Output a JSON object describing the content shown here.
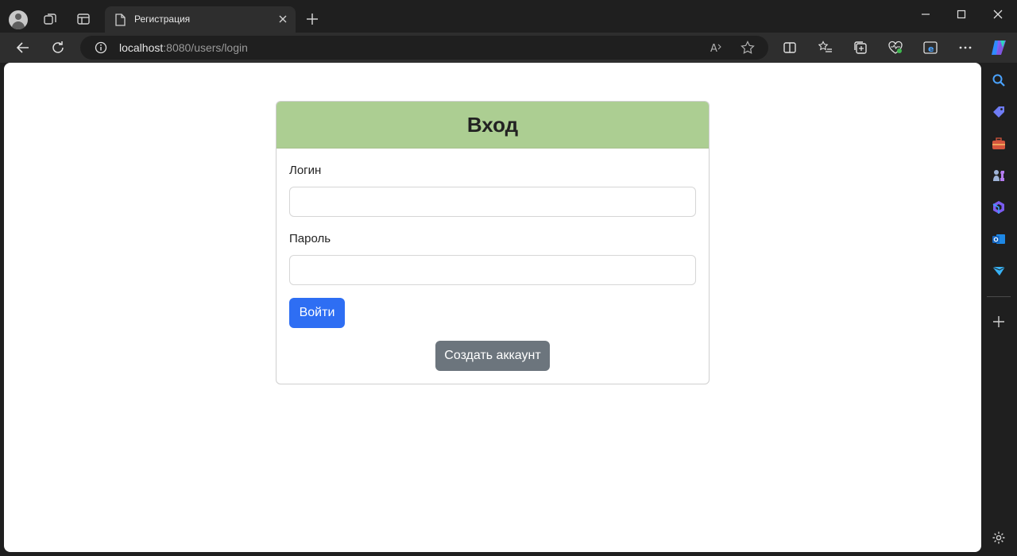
{
  "browser": {
    "tab_title": "Регистрация",
    "url_host": "localhost",
    "url_rest": ":8080/users/login",
    "read_aloud_label": "A⁾"
  },
  "form": {
    "title": "Вход",
    "login_label": "Логин",
    "login_value": "",
    "password_label": "Пароль",
    "password_value": "",
    "submit_label": "Войти",
    "create_account_label": "Создать аккаунт"
  },
  "colors": {
    "header_bg": "#acce92",
    "primary_button": "#2e6ef3",
    "secondary_button": "#6c757d"
  }
}
